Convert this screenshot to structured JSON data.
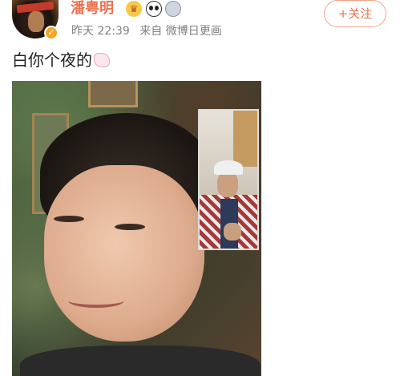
{
  "user": {
    "name": "潘粤明",
    "meta_time": "昨天 22:39",
    "meta_source": "来自 微博日更画",
    "follow_label": "+关注"
  },
  "post": {
    "text": "白你个夜的"
  },
  "colors": {
    "username": "#eb7350",
    "meta": "#808080",
    "follow_border": "#f0a485"
  },
  "icons": [
    "verified-badge-icon",
    "crown-medal-icon",
    "panda-medal-icon",
    "silver-medal-icon",
    "blush-emoji-icon"
  ]
}
